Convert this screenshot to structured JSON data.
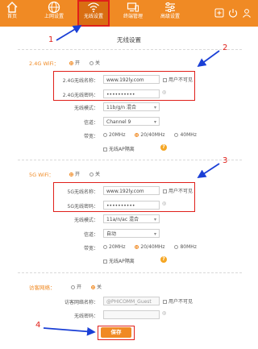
{
  "nav": {
    "home": "首页",
    "internet": "上网设置",
    "wireless": "无线设置",
    "devices": "终端管理",
    "advanced": "高级设置"
  },
  "title": "无线设置",
  "wifi24": {
    "label": "2.4G WiFi：",
    "on": "开",
    "off": "关",
    "ssid_label": "2.4G无线名称：",
    "ssid_value": "www.192ly.com",
    "hide_label": "用户不可见",
    "pwd_label": "2.4G无线密码：",
    "pwd_value": "••••••••••",
    "mode_label": "无线模式：",
    "mode_value": "11b/g/n 混合",
    "channel_label": "信道：",
    "channel_value": "Channel 9",
    "bw_label": "带宽：",
    "bw_opts": [
      "20MHz",
      "20/40MHz",
      "40MHz"
    ],
    "isolation": "无线AP隔离"
  },
  "wifi5": {
    "label": "5G WiFi：",
    "on": "开",
    "off": "关",
    "ssid_label": "5G无线名称：",
    "ssid_value": "www.192ly.com",
    "hide_label": "用户不可见",
    "pwd_label": "5G无线密码：",
    "pwd_value": "••••••••••",
    "mode_label": "无线模式：",
    "mode_value": "11a/n/ac 混合",
    "channel_label": "信道：",
    "channel_value": "自动",
    "bw_label": "带宽：",
    "bw_opts": [
      "20MHz",
      "20/40MHz",
      "80MHz"
    ],
    "isolation": "无线AP隔离"
  },
  "guest": {
    "label": "访客网络：",
    "on": "开",
    "off": "关",
    "ssid_label": "访客网络名称：",
    "ssid_placeholder": "@PHICOMM_Guest",
    "hide_label": "用户不可见",
    "pwd_label": "无线密码："
  },
  "save": "保存",
  "annotations": [
    "1",
    "2",
    "3",
    "4"
  ],
  "colors": {
    "accent": "#f08a24",
    "annotation": "#e0201a",
    "arrow": "#1a3fd6"
  }
}
